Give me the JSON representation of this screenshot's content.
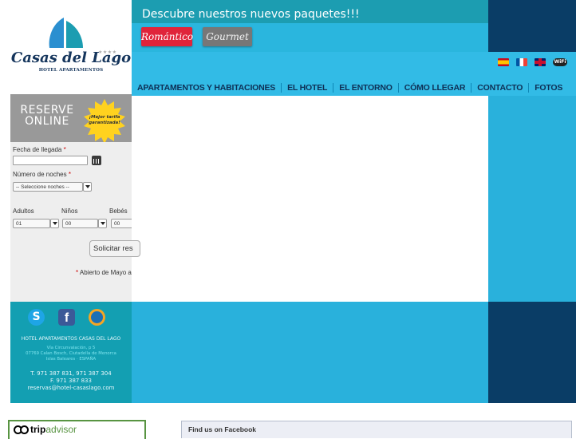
{
  "logo": {
    "name": "Casas del Lago",
    "stars": "★★★★",
    "subtitle": "HOTEL APARTAMENTOS"
  },
  "header": {
    "promo_title": "Descubre nuestros nuevos paquetes!!!",
    "packages": [
      "Romántico",
      "Gourmet"
    ],
    "languages": [
      {
        "icon": "spanish-flag-icon"
      },
      {
        "icon": "french-flag-icon"
      },
      {
        "icon": "uk-flag-icon"
      }
    ],
    "wifi_label": "WiFi"
  },
  "nav": {
    "items": [
      "APARTAMENTOS Y HABITACIONES",
      "EL HOTEL",
      "EL ENTORNO",
      "CÓMO LLEGAR",
      "CONTACTO",
      "FOTOS"
    ]
  },
  "booking": {
    "title_line1": "RESERVE",
    "title_line2": "ONLINE",
    "badge_line1": "¡Mejor tarifa",
    "badge_line2": "garantizada!",
    "arrival_label": "Fecha de llegada",
    "arrival_value": "",
    "nights_label": "Número de noches",
    "nights_value": "-- Seleccione noches --",
    "adults_label": "Adultos",
    "adults_value": "01",
    "children_label": "Niños",
    "children_value": "00",
    "babies_label": "Bebés",
    "babies_value": "00",
    "submit_label": "Solicitar res",
    "note": "Abierto de Mayo a",
    "required_mark": "*"
  },
  "footer": {
    "social": [
      {
        "icon": "skype-icon"
      },
      {
        "icon": "facebook-icon"
      },
      {
        "icon": "thomas-cook-icon"
      }
    ],
    "hotel_name": "HOTEL APARTAMENTOS CASAS DEL LAGO",
    "address_line1": "Vía Circunvalación, p 5",
    "address_line2": "07769 Calan Bosch, Ciutadella de Menorca",
    "address_line3": "Islas Baleares · ESPAÑA",
    "phone": "T. 971 387 831, 971 387 304",
    "fax": "F. 971 387 833",
    "email": "reservas@hotel-casaslago.com"
  },
  "widgets": {
    "tripadvisor_trip": "trip",
    "tripadvisor_advisor": "advisor",
    "facebook_title": "Find us on Facebook"
  },
  "colors": {
    "teal": "#1c9db1",
    "sky_blue": "#2ab6de",
    "navy": "#0a3d66",
    "nav_text": "#0e2f55",
    "romantico_red": "#e0243a",
    "gourmet_gray": "#777777",
    "tripadvisor_green": "#589442"
  }
}
